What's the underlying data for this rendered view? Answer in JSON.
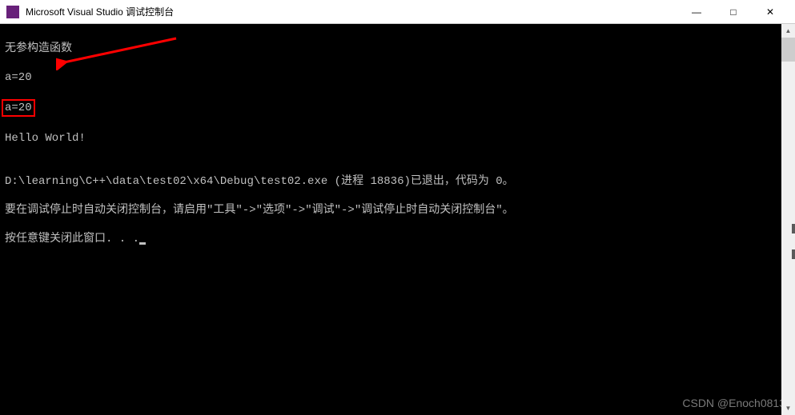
{
  "titlebar": {
    "title": "Microsoft Visual Studio 调试控制台",
    "icon_label": "VS"
  },
  "controls": {
    "minimize": "—",
    "maximize": "□",
    "close": "✕"
  },
  "console": {
    "line1": "无参构造函数",
    "line2": "a=20",
    "line3": "a=20",
    "line4": "Hello World!",
    "line5": "",
    "line6": "D:\\learning\\C++\\data\\test02\\x64\\Debug\\test02.exe (进程 18836)已退出，代码为 0。",
    "line7": "要在调试停止时自动关闭控制台，请启用\"工具\"->\"选项\"->\"调试\"->\"调试停止时自动关闭控制台\"。",
    "line8": "按任意键关闭此窗口. . ."
  },
  "scrollbar": {
    "up": "▲",
    "down": "▼"
  },
  "watermark": "CSDN @Enoch0813"
}
